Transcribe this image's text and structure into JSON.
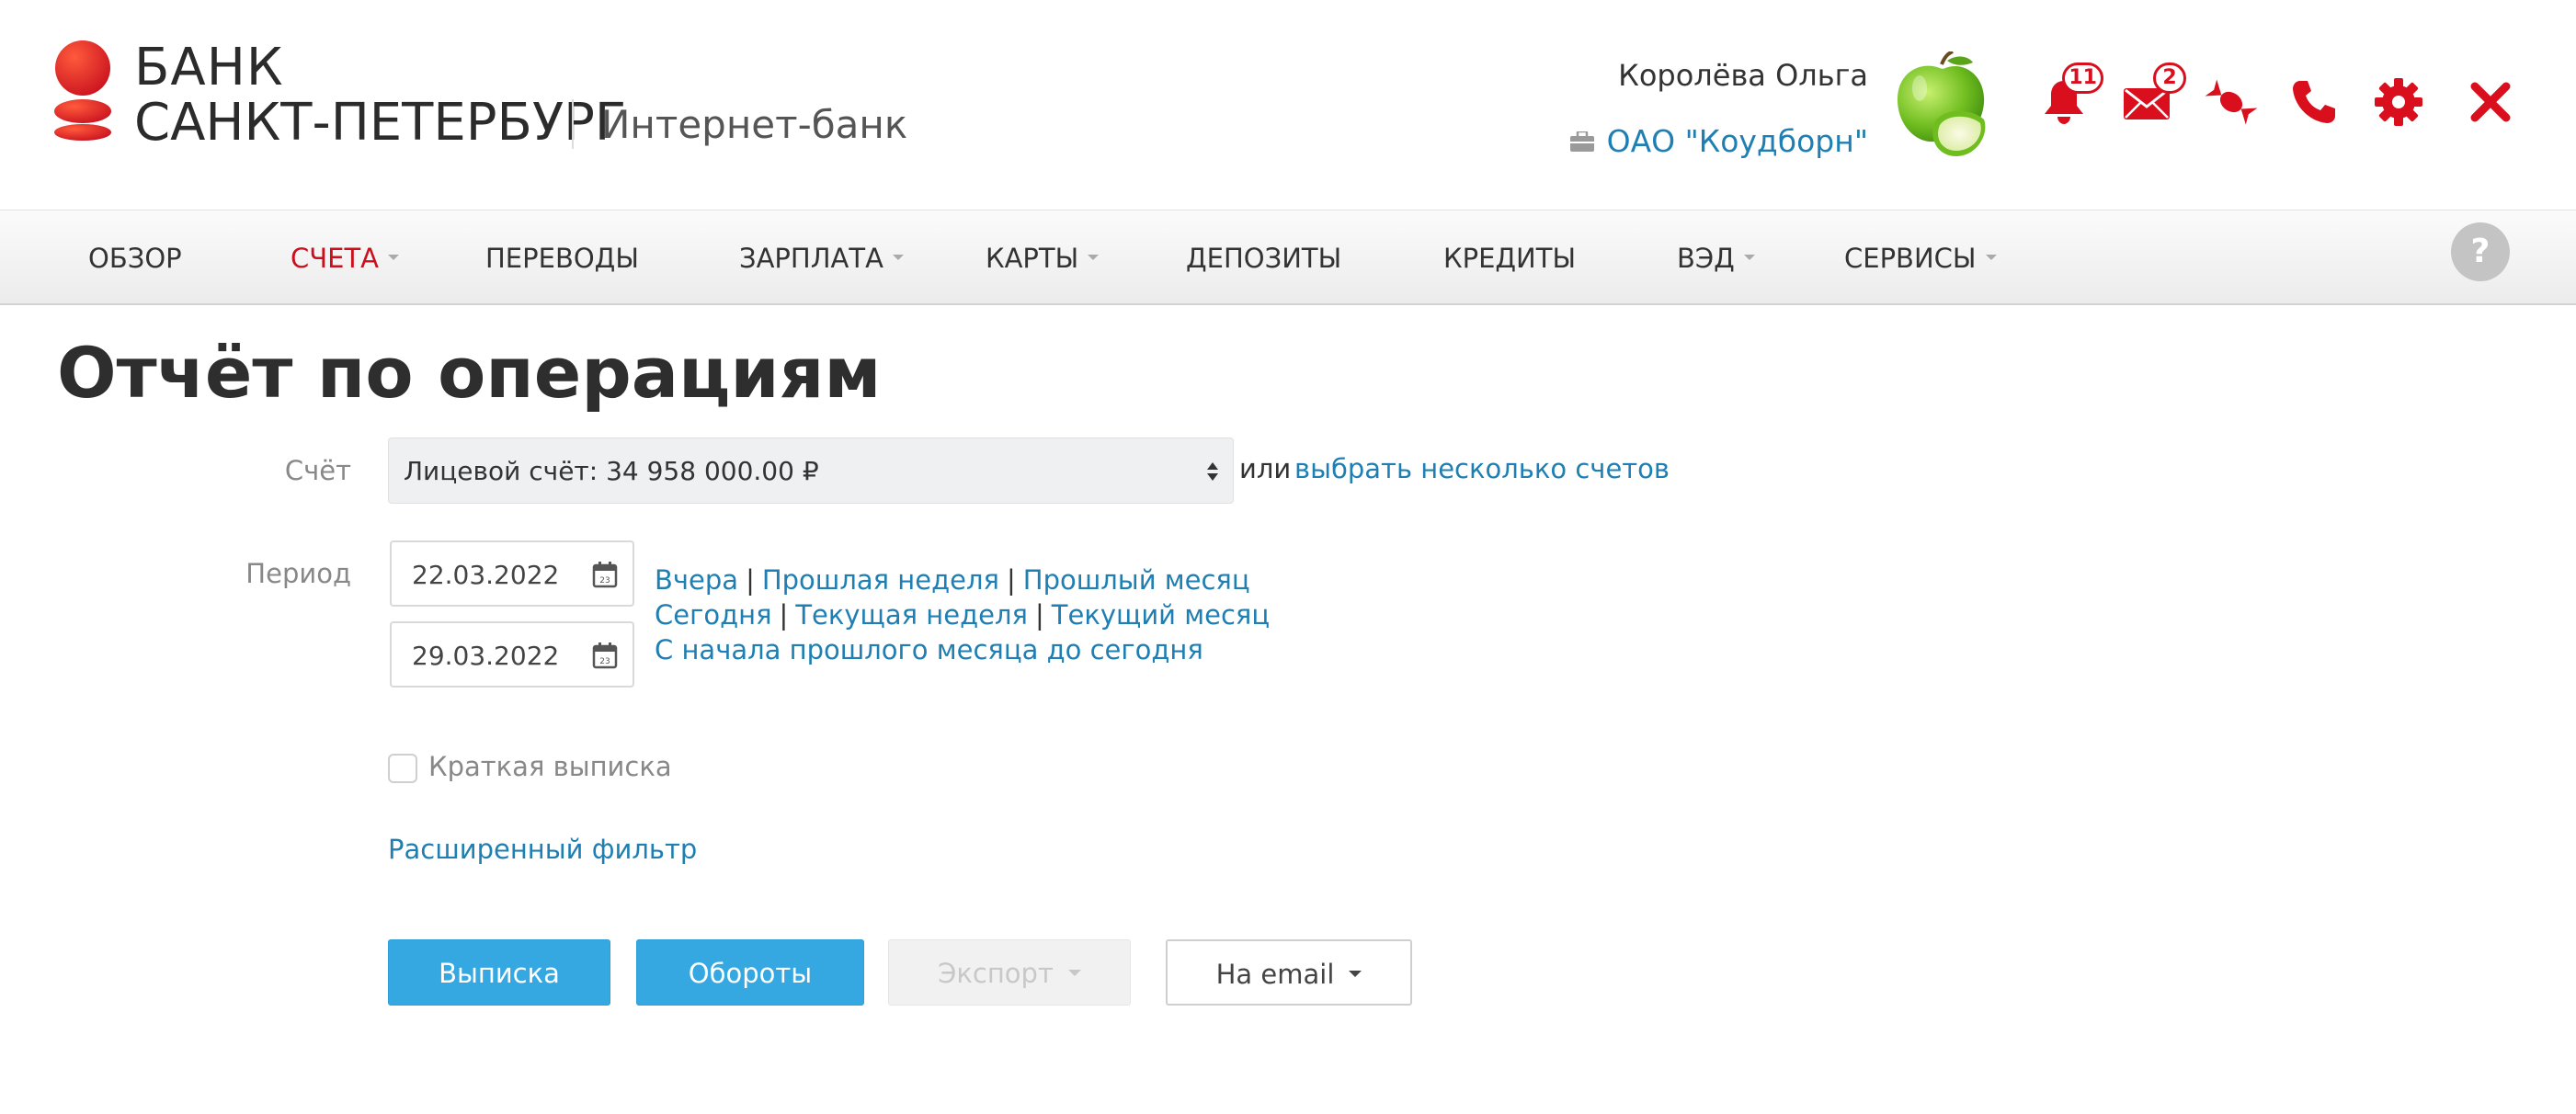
{
  "header": {
    "brand_line1": "БАНК",
    "brand_line2": "САНКТ-ПЕТЕРБУРГ",
    "brand_sub": "Интернет-банк",
    "user_name": "Королёва Ольга",
    "company": "ОАО \"Коудборн\"",
    "notifications_count": "11",
    "messages_count": "2",
    "icons": [
      "bell-icon",
      "mail-icon",
      "candy-icon",
      "phone-icon",
      "gear-icon",
      "close-icon"
    ],
    "brand_color": "#d90f1e"
  },
  "nav": {
    "items": [
      {
        "label": "ОБЗОР",
        "dropdown": false,
        "active": false
      },
      {
        "label": "СЧЕТА",
        "dropdown": true,
        "active": true
      },
      {
        "label": "ПЕРЕВОДЫ",
        "dropdown": false,
        "active": false
      },
      {
        "label": "ЗАРПЛАТА",
        "dropdown": true,
        "active": false
      },
      {
        "label": "КАРТЫ",
        "dropdown": true,
        "active": false
      },
      {
        "label": "ДЕПОЗИТЫ",
        "dropdown": false,
        "active": false
      },
      {
        "label": "КРЕДИТЫ",
        "dropdown": false,
        "active": false
      },
      {
        "label": "ВЭД",
        "dropdown": true,
        "active": false
      },
      {
        "label": "СЕРВИСЫ",
        "dropdown": true,
        "active": false
      }
    ],
    "help_label": "?"
  },
  "page": {
    "title": "Отчёт по операциям",
    "account_label": "Счёт",
    "account_value": "Лицевой счёт: 34 958 000.00 ₽",
    "or_text": "или",
    "choose_multiple": "выбрать несколько счетов",
    "period_label": "Период",
    "date_from": "22.03.2022",
    "date_to": "29.03.2022",
    "calendar_day": "23",
    "quick_periods": {
      "yesterday": "Вчера",
      "last_week": "Прошлая неделя",
      "last_month": "Прошлый месяц",
      "today": "Сегодня",
      "this_week": "Текущая неделя",
      "this_month": "Текущий месяц",
      "since_last_month": "С начала прошлого месяца до сегодня",
      "separator": "|"
    },
    "short_statement": "Краткая выписка",
    "short_statement_checked": false,
    "extended_filter": "Расширенный фильтр"
  },
  "buttons": {
    "statement": "Выписка",
    "turnover": "Обороты",
    "export": "Экспорт",
    "email": "На email"
  },
  "colors": {
    "accent_red": "#c9111e",
    "link_blue": "#1f7fb3",
    "button_blue": "#35a7e1"
  }
}
